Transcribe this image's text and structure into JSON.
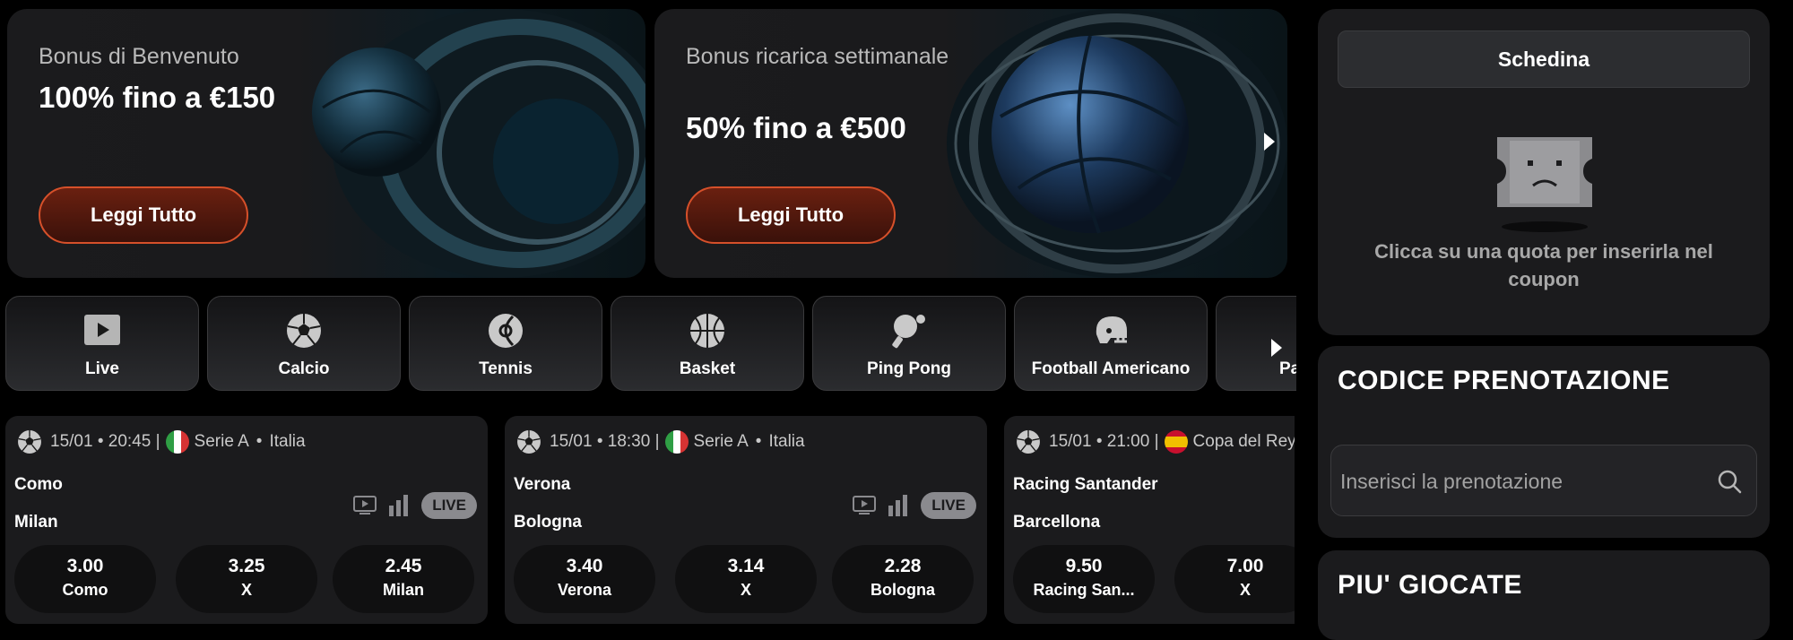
{
  "banners": [
    {
      "subtitle": "Bonus di Benvenuto",
      "headline": "100% fino a €150",
      "button": "Leggi Tutto"
    },
    {
      "subtitle": "Bonus ricarica settimanale",
      "headline": "50% fino a €500",
      "button": "Leggi Tutto"
    }
  ],
  "sports": [
    {
      "label": "Live",
      "icon": "live-play-icon"
    },
    {
      "label": "Calcio",
      "icon": "soccer-ball-icon"
    },
    {
      "label": "Tennis",
      "icon": "tennis-ball-icon"
    },
    {
      "label": "Basket",
      "icon": "basketball-icon"
    },
    {
      "label": "Ping Pong",
      "icon": "ping-pong-icon"
    },
    {
      "label": "Football Americano",
      "icon": "football-helmet-icon"
    },
    {
      "label": "Pa",
      "icon": "sport-icon"
    }
  ],
  "matches": [
    {
      "datetime": "15/01 • 20:45 |",
      "flag": "italy-flag-icon",
      "league": "Serie A",
      "sep": "•",
      "country": "Italia",
      "home": "Como",
      "away": "Milan",
      "live": "LIVE",
      "odds": [
        {
          "value": "3.00",
          "label": "Como"
        },
        {
          "value": "3.25",
          "label": "X"
        },
        {
          "value": "2.45",
          "label": "Milan"
        }
      ]
    },
    {
      "datetime": "15/01 • 18:30 |",
      "flag": "italy-flag-icon",
      "league": "Serie A",
      "sep": "•",
      "country": "Italia",
      "home": "Verona",
      "away": "Bologna",
      "live": "LIVE",
      "odds": [
        {
          "value": "3.40",
          "label": "Verona"
        },
        {
          "value": "3.14",
          "label": "X"
        },
        {
          "value": "2.28",
          "label": "Bologna"
        }
      ]
    },
    {
      "datetime": "15/01 • 21:00 |",
      "flag": "spain-flag-icon",
      "league": "Copa del Rey",
      "home": "Racing Santander",
      "away": "Barcellona",
      "odds": [
        {
          "value": "9.50",
          "label": "Racing San..."
        },
        {
          "value": "7.00",
          "label": "X"
        }
      ]
    }
  ],
  "betslip": {
    "tab": "Schedina",
    "empty_message": "Clicca su una quota per inserirla nel coupon"
  },
  "booking": {
    "title": "CODICE PRENOTAZIONE",
    "placeholder": "Inserisci la prenotazione"
  },
  "most_played": {
    "title": "PIU' GIOCATE"
  },
  "colors": {
    "accent_border": "#d6502a",
    "card_bg": "#1b1b1d",
    "page_bg": "#000000"
  }
}
